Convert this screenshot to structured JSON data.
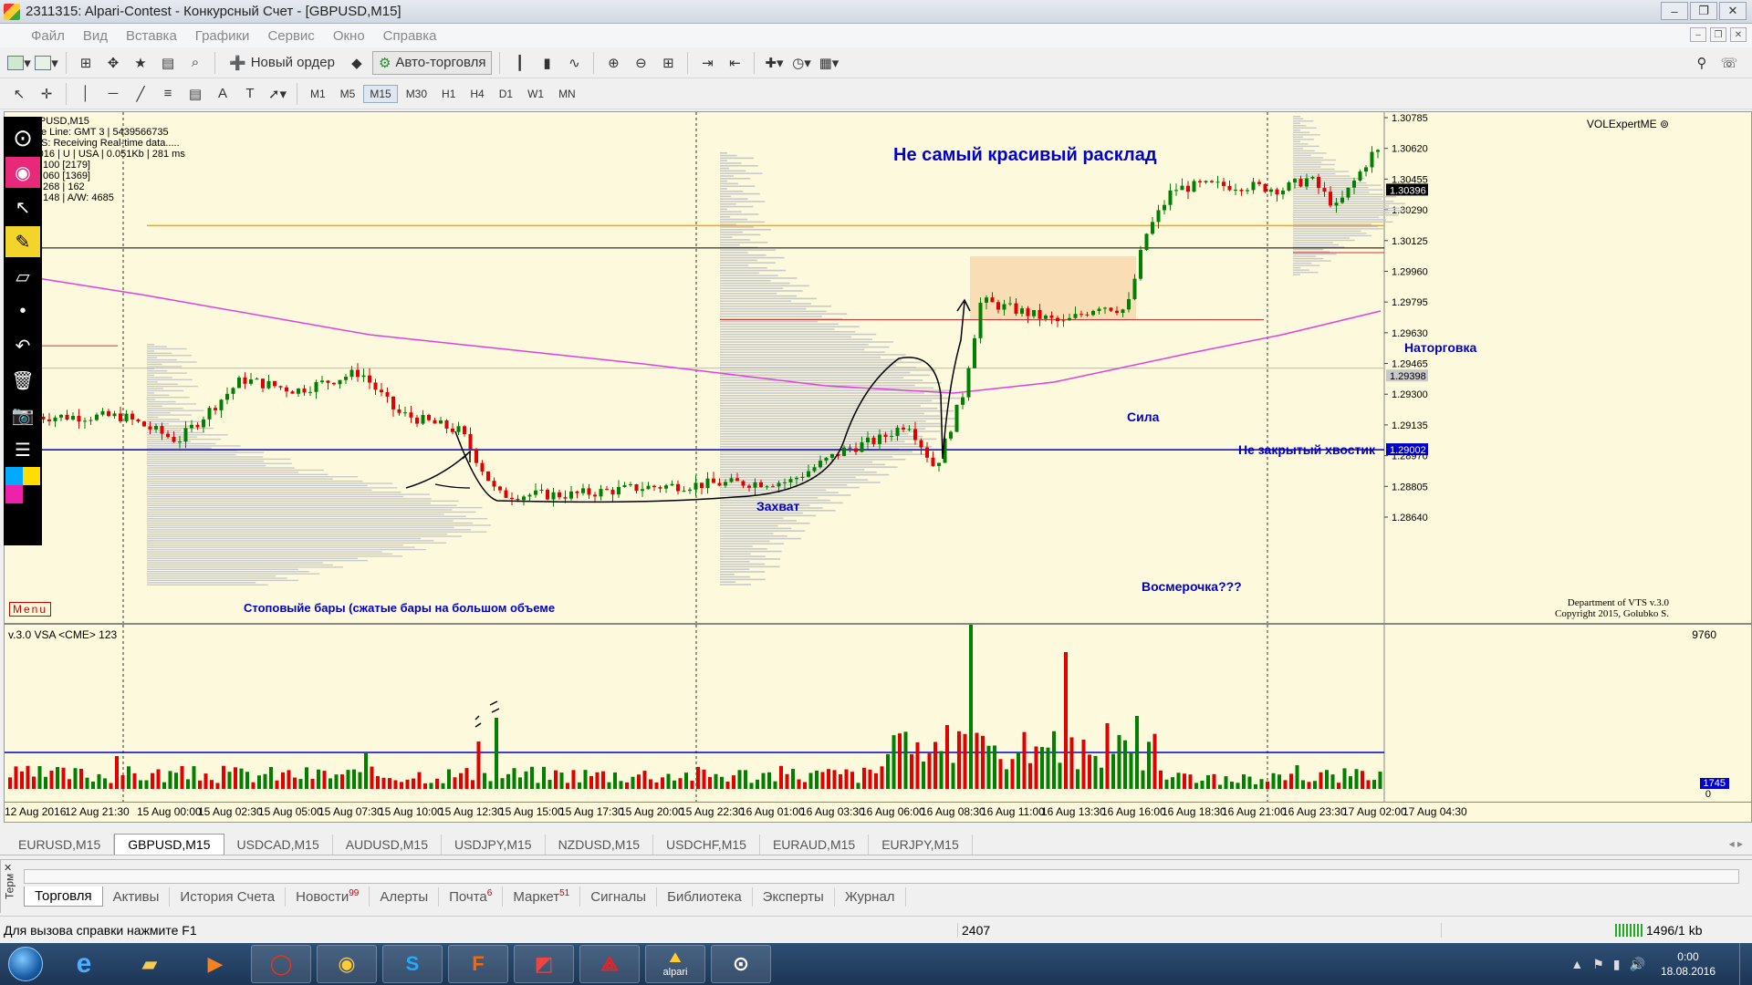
{
  "window": {
    "title": "2311315: Alpari-Contest - Конкурсный Счет - [GBPUSD,M15]",
    "controls": [
      "–",
      "❐",
      "✕"
    ]
  },
  "menu": [
    "Файл",
    "Вид",
    "Вставка",
    "Графики",
    "Сервис",
    "Окно",
    "Справка"
  ],
  "toolbar": {
    "new_order": "Новый ордер",
    "auto_trading": "Авто-торговля"
  },
  "timeframes": [
    "M1",
    "M5",
    "M15",
    "M30",
    "H1",
    "H4",
    "D1",
    "W1",
    "MN"
  ],
  "active_timeframe": "M15",
  "chart": {
    "symbol_info": "GBPUSD,M15",
    "info_lines": [
      "e Line: GMT 3 | 5439566735",
      "S:  Receiving Real-time data.....",
      "13/9/2016 | U | USA | 0.051Kb | 281 ms",
      "100  [2179]",
      "060  [1369]",
      "268  | 162",
      "148  | A/W: 4685"
    ],
    "headline": "Не самый красивый расклад",
    "annotations": {
      "zahvat": "Захват",
      "sila": "Сила",
      "natorgovka": "Наторговка",
      "hvostik": "Не закрытый хвостик",
      "vosmerochka": "Восмерочка???",
      "stop_bars": "Стоповыйе бары (сжатые бары на большом объеме"
    },
    "indicator_name": "VOLExpertME",
    "copyright_1": "Department of VTS  v.3.0",
    "copyright_2": "Copyright 2015, Golubko S.",
    "price_labels": [
      "1.30785",
      "1.30620",
      "1.30455",
      "1.30290",
      "1.30125",
      "1.29960",
      "1.29795",
      "1.29630",
      "1.29465",
      "1.29300",
      "1.29135",
      "1.28970",
      "1.28805",
      "1.28640"
    ],
    "current_price": "1.30396",
    "gray_price": "1.29398",
    "blue_price": "1.29002",
    "menu_button": "Menu",
    "sub_title": "v.3.0 VSA <CME> 123",
    "sub_max": "9760",
    "sub_level": "1745",
    "sub_zero": "0",
    "time_labels": [
      "12 Aug 2016",
      "12 Aug 21:30",
      "15 Aug 00:00",
      "15 Aug 02:30",
      "15 Aug 05:00",
      "15 Aug 07:30",
      "15 Aug 10:00",
      "15 Aug 12:30",
      "15 Aug 15:00",
      "15 Aug 17:30",
      "15 Aug 20:00",
      "15 Aug 22:30",
      "16 Aug 01:00",
      "16 Aug 03:30",
      "16 Aug 06:00",
      "16 Aug 08:30",
      "16 Aug 11:00",
      "16 Aug 13:30",
      "16 Aug 16:00",
      "16 Aug 18:30",
      "16 Aug 21:00",
      "16 Aug 23:30",
      "17 Aug 02:00",
      "17 Aug 04:30"
    ]
  },
  "symbol_tabs": [
    "EURUSD,M15",
    "GBPUSD,M15",
    "USDCAD,M15",
    "AUDUSD,M15",
    "USDJPY,M15",
    "NZDUSD,M15",
    "USDCHF,M15",
    "EURAUD,M15",
    "EURJPY,M15"
  ],
  "active_symbol_tab": "GBPUSD,M15",
  "terminal": {
    "side_label": "Терм",
    "tabs": [
      {
        "label": "Торговля",
        "badge": ""
      },
      {
        "label": "Активы",
        "badge": ""
      },
      {
        "label": "История Счета",
        "badge": ""
      },
      {
        "label": "Новости",
        "badge": "99"
      },
      {
        "label": "Алерты",
        "badge": ""
      },
      {
        "label": "Почта",
        "badge": "6"
      },
      {
        "label": "Маркет",
        "badge": "51"
      },
      {
        "label": "Сигналы",
        "badge": ""
      },
      {
        "label": "Библиотека",
        "badge": ""
      },
      {
        "label": "Эксперты",
        "badge": ""
      },
      {
        "label": "Журнал",
        "badge": ""
      }
    ]
  },
  "status": {
    "help": "Для вызова справки нажмите F1",
    "value": "2407",
    "connection": "1496/1 kb"
  },
  "taskbar": {
    "time": "0:00",
    "date": "18.08.2016",
    "alpari_label": "alpari"
  },
  "colors": {
    "chart_bg": "#fcf9dc",
    "bull": "#008000",
    "bear": "#e00000",
    "annotation": "#0000c8",
    "ma": "#e040e0",
    "level_orange": "#ffa500"
  }
}
